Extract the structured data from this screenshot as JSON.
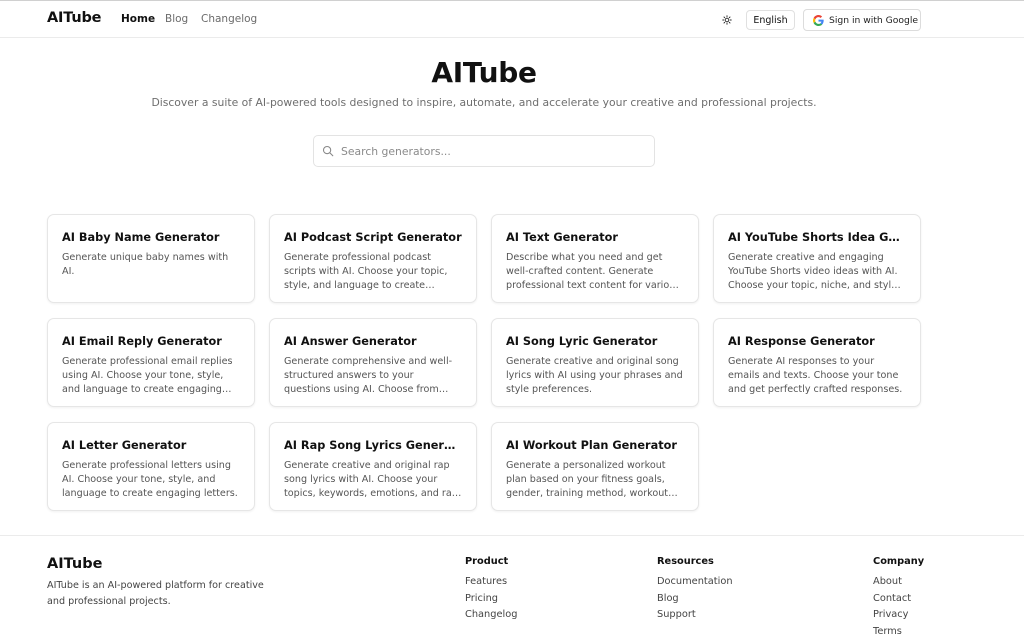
{
  "nav": {
    "logo": "AITube",
    "links": [
      "Home",
      "Blog",
      "Changelog"
    ],
    "language": "English",
    "signin": "Sign in with Google"
  },
  "hero": {
    "title": "AITube",
    "subtitle": "Discover a suite of AI-powered tools designed to inspire, automate, and accelerate your creative and professional projects."
  },
  "search": {
    "placeholder": "Search generators..."
  },
  "cards": [
    {
      "title": "AI Baby Name Generator",
      "desc": "Generate unique baby names with AI."
    },
    {
      "title": "AI Podcast Script Generator",
      "desc": "Generate professional podcast scripts with AI. Choose your topic, style, and language to create engaging podcast scripts."
    },
    {
      "title": "AI Text Generator",
      "desc": "Describe what you need and get well-crafted content. Generate professional text content for various purposes."
    },
    {
      "title": "AI YouTube Shorts Idea Generator",
      "desc": "Generate creative and engaging YouTube Shorts video ideas with AI. Choose your topic, niche, and style to get ideas."
    },
    {
      "title": "AI Email Reply Generator",
      "desc": "Generate professional email replies using AI. Choose your tone, style, and language to create engaging replies."
    },
    {
      "title": "AI Answer Generator",
      "desc": "Generate comprehensive and well-structured answers to your questions using AI. Choose from various tones and styles."
    },
    {
      "title": "AI Song Lyric Generator",
      "desc": "Generate creative and original song lyrics with AI using your phrases and style preferences."
    },
    {
      "title": "AI Response Generator",
      "desc": "Generate AI responses to your emails and texts. Choose your tone and get perfectly crafted responses."
    },
    {
      "title": "AI Letter Generator",
      "desc": "Generate professional letters using AI. Choose your tone, style, and language to create engaging letters."
    },
    {
      "title": "AI Rap Song Lyrics Generator",
      "desc": "Generate creative and original rap song lyrics with AI. Choose your topics, keywords, emotions, and rap style."
    },
    {
      "title": "AI Workout Plan Generator",
      "desc": "Generate a personalized workout plan based on your fitness goals, gender, training method, workout frequency and more."
    }
  ],
  "footer": {
    "logo": "AITube",
    "desc": "AITube is an AI-powered platform for creative and professional projects.",
    "columns": [
      {
        "heading": "Product",
        "links": [
          "Features",
          "Pricing",
          "Changelog"
        ]
      },
      {
        "heading": "Resources",
        "links": [
          "Documentation",
          "Blog",
          "Support"
        ]
      },
      {
        "heading": "Company",
        "links": [
          "About",
          "Contact",
          "Privacy",
          "Terms"
        ]
      }
    ]
  }
}
